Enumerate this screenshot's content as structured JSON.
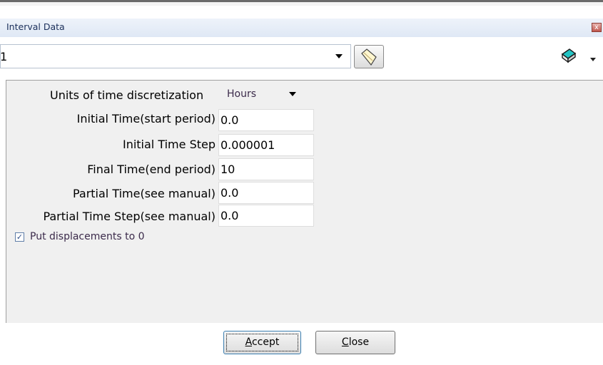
{
  "window": {
    "title": "Interval Data",
    "close_glyph": "x"
  },
  "selector": {
    "value": "1",
    "icons": [
      "note-icon",
      "eraser-icon"
    ]
  },
  "form": {
    "units": {
      "label": "Units of time discretization",
      "value": "Hours"
    },
    "fields": [
      {
        "label": "Initial Time(start period)",
        "value": "0.0"
      },
      {
        "label": "Initial Time Step",
        "value": "0.000001"
      },
      {
        "label": "Final Time(end period)",
        "value": "10"
      },
      {
        "label": "Partial Time(see manual)",
        "value": "0.0"
      },
      {
        "label": "Partial Time Step(see manual)",
        "value": "0.0"
      }
    ],
    "checkbox": {
      "label": "Put displacements to 0",
      "checked": true
    }
  },
  "buttons": {
    "accept": {
      "mnemonic": "A",
      "rest": "ccept"
    },
    "close": {
      "mnemonic": "C",
      "rest": "lose"
    }
  },
  "colors": {
    "accent": "#3c7fb1",
    "title_text": "#1b2f5a",
    "panel": "#f0f0f0"
  }
}
